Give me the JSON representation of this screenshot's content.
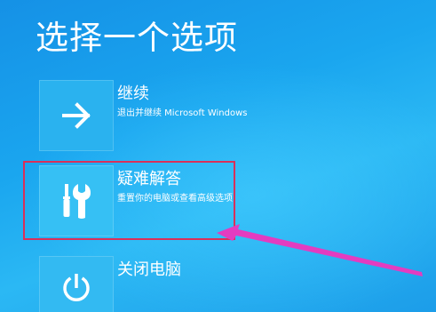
{
  "page": {
    "title": "选择一个选项"
  },
  "options": [
    {
      "label": "继续",
      "description": "退出并继续 Microsoft Windows",
      "icon": "arrow-right-icon"
    },
    {
      "label": "疑难解答",
      "description": "重置你的电脑或查看高级选项",
      "icon": "wrench-screwdriver-icon"
    },
    {
      "label": "关闭电脑",
      "description": "",
      "icon": "power-icon"
    }
  ],
  "colors": {
    "background": "#1aa6ef",
    "tile": "#2ab2ef",
    "highlight_box": "#d9305a",
    "annotation_arrow": "#e33cc0"
  }
}
